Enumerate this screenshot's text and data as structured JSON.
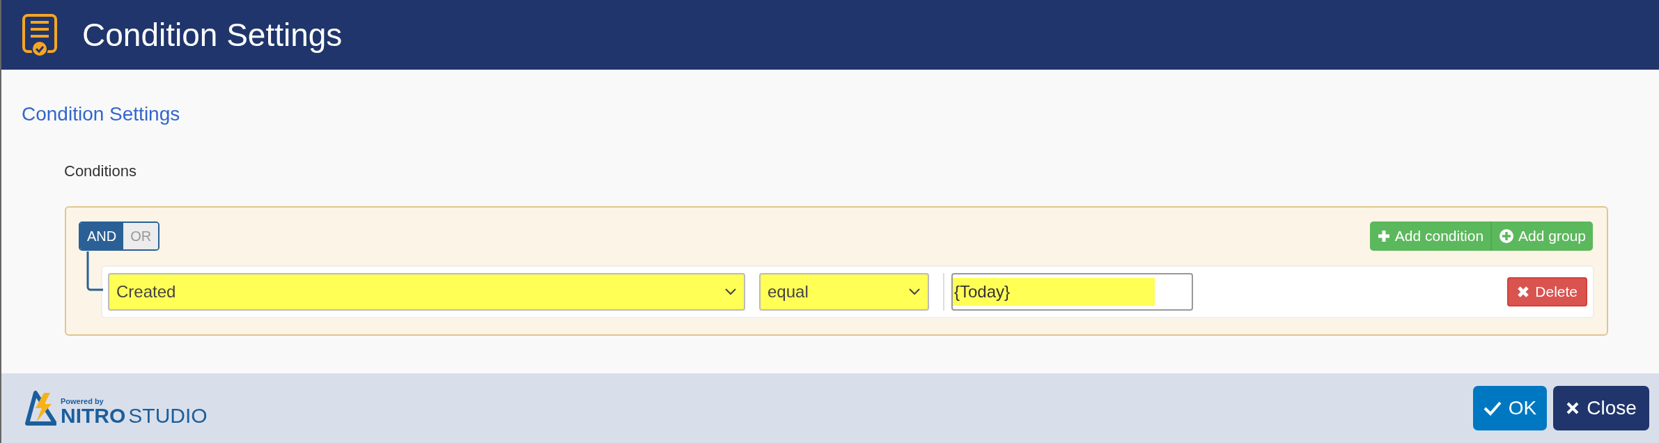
{
  "header": {
    "title": "Condition Settings"
  },
  "section_title": "Condition Settings",
  "conditions_label": "Conditions",
  "group": {
    "conjunctions": [
      {
        "label": "AND",
        "selected": true
      },
      {
        "label": "OR",
        "selected": false
      }
    ],
    "add_buttons": [
      {
        "label": "Add condition",
        "kind": "plus"
      },
      {
        "label": "Add group",
        "kind": "circle-plus"
      }
    ],
    "rules": [
      {
        "field": "Created",
        "field_highlighted": true,
        "operator": "equal",
        "operator_highlighted": true,
        "value": "{Today}",
        "value_highlighted": true,
        "delete_label": "Delete"
      }
    ]
  },
  "footer": {
    "logo_small": "Powered by",
    "logo_bold": "NITRO",
    "logo_light": "STUDIO",
    "buttons": [
      {
        "label": "OK",
        "kind": "ok"
      },
      {
        "label": "Close",
        "kind": "close"
      }
    ]
  }
}
